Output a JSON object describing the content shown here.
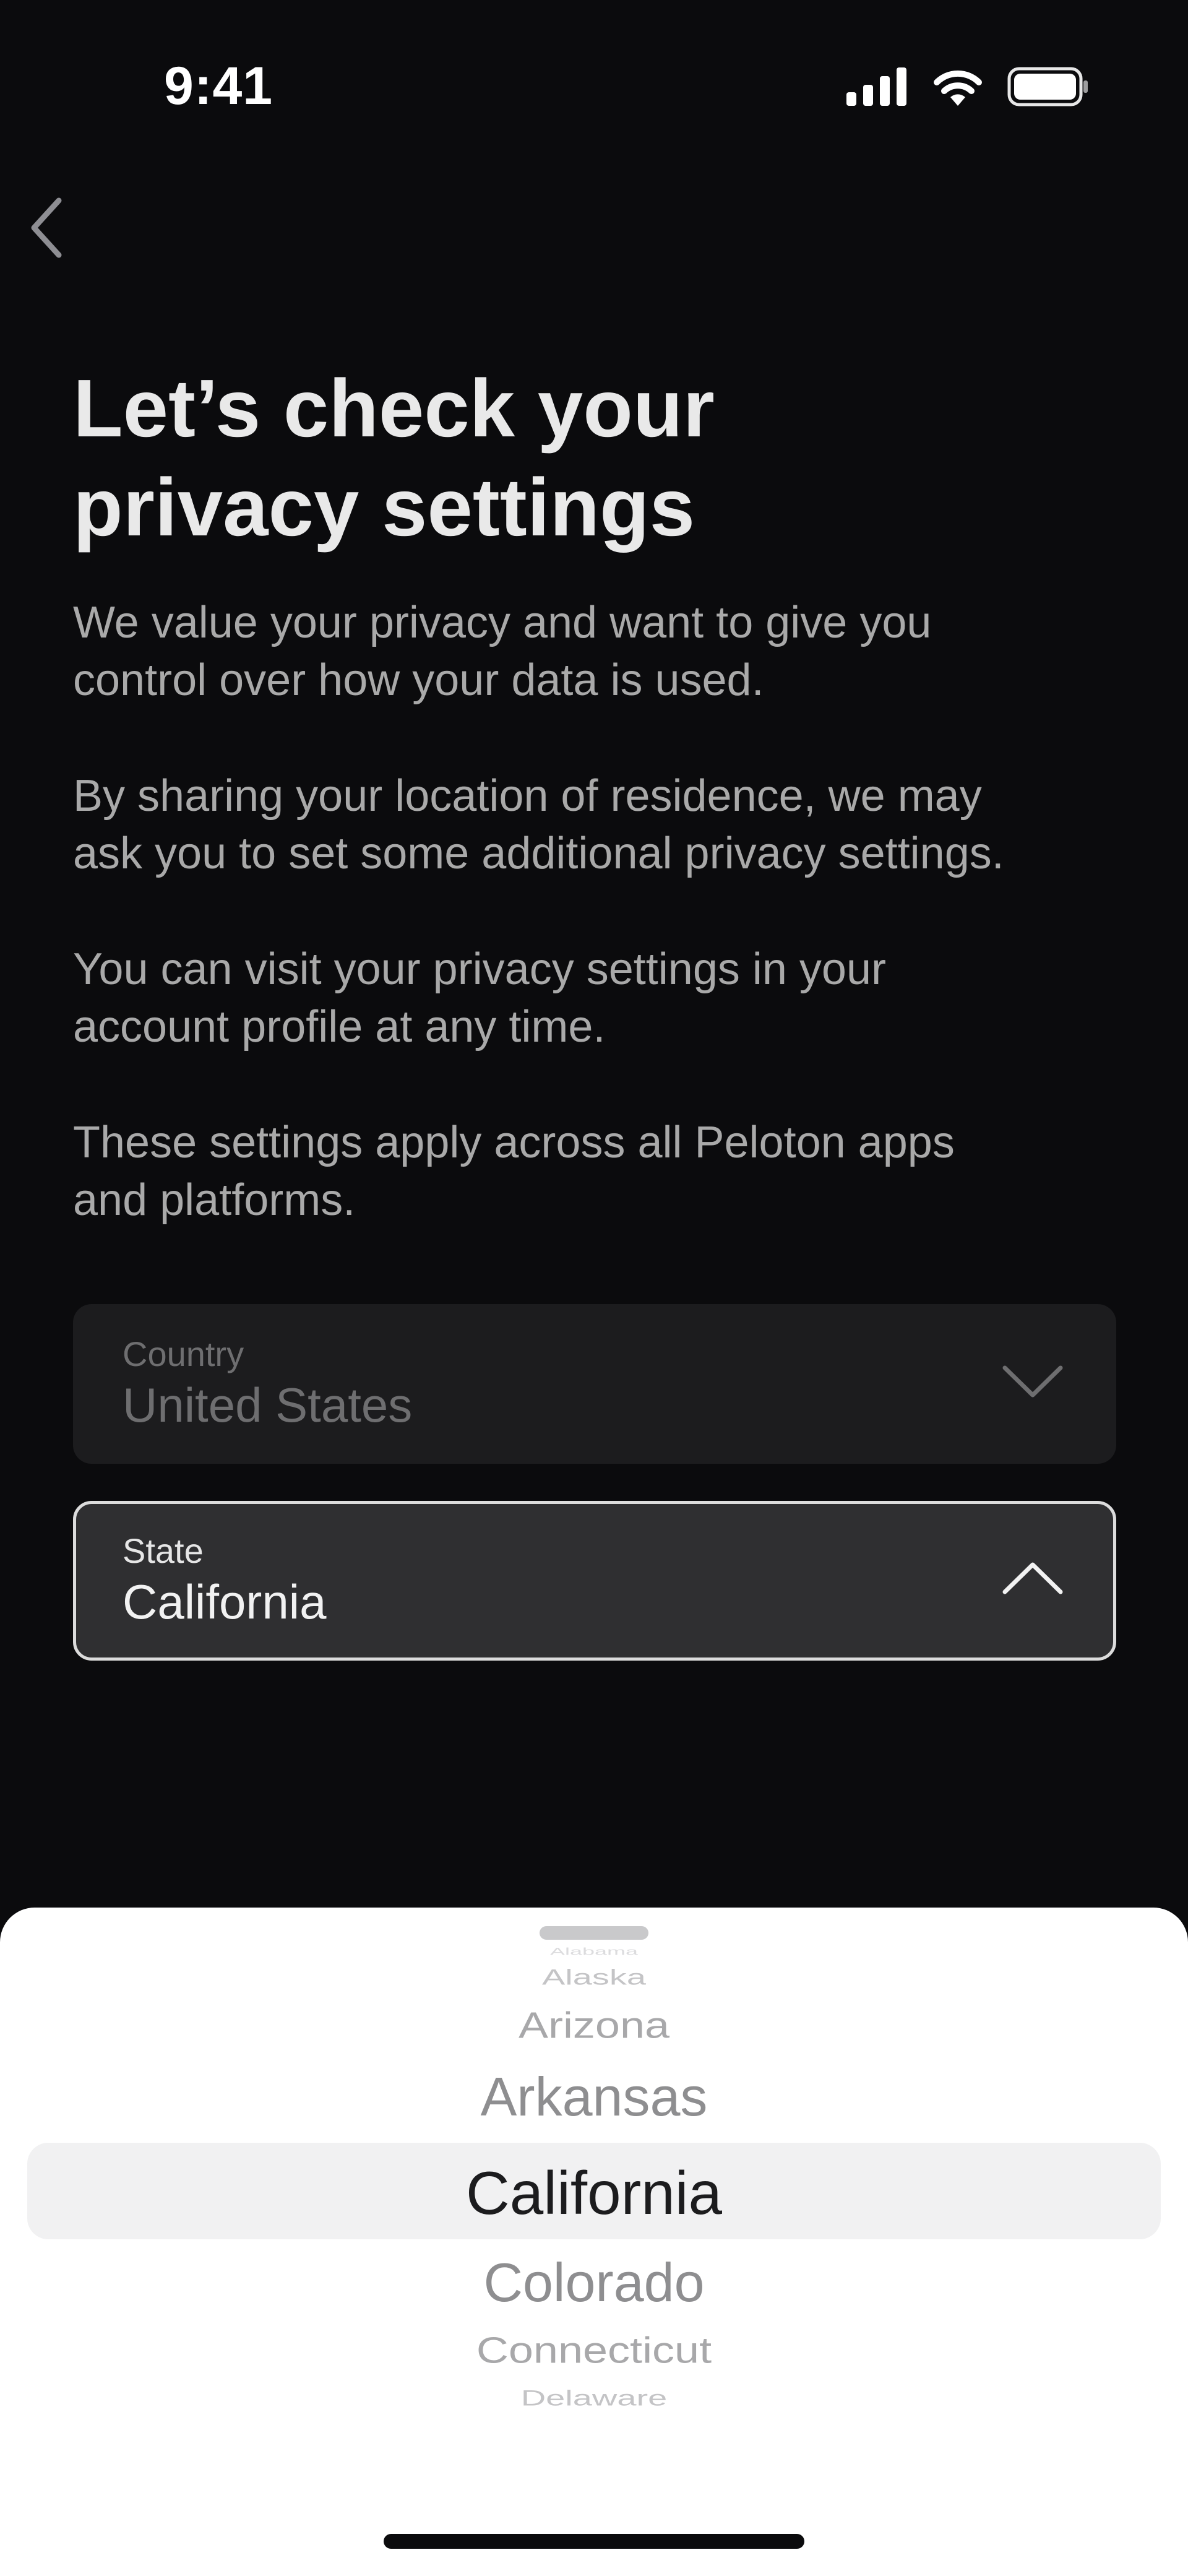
{
  "status_bar": {
    "time": "9:41",
    "icons": [
      "cellular-signal-icon",
      "wifi-icon",
      "battery-icon"
    ]
  },
  "nav": {
    "back_icon": "chevron-left-icon"
  },
  "page": {
    "title_line1": "Let’s check your",
    "title_line2": "privacy settings",
    "paragraphs": [
      [
        "We value your privacy and want to give you",
        "control over how your data is used."
      ],
      [
        "By sharing your location of residence, we may",
        "ask you to set some additional privacy settings."
      ],
      [
        "You can visit your privacy settings in your",
        "account profile at any time."
      ],
      [
        "These settings apply across all Peloton apps",
        "and platforms."
      ]
    ]
  },
  "country_field": {
    "label": "Country",
    "value": "United States",
    "icon": "chevron-down-icon"
  },
  "state_field": {
    "label": "State",
    "value": "California",
    "icon": "chevron-up-icon"
  },
  "picker": {
    "items": [
      "Alabama",
      "Alaska",
      "Arizona",
      "Arkansas",
      "California",
      "Colorado",
      "Connecticut",
      "Delaware"
    ],
    "selected": "California"
  },
  "colors": {
    "background": "#0b0b0d",
    "sheet": "#ffffff",
    "title": "#e9e9e9",
    "body_text": "#a9a9a9"
  }
}
